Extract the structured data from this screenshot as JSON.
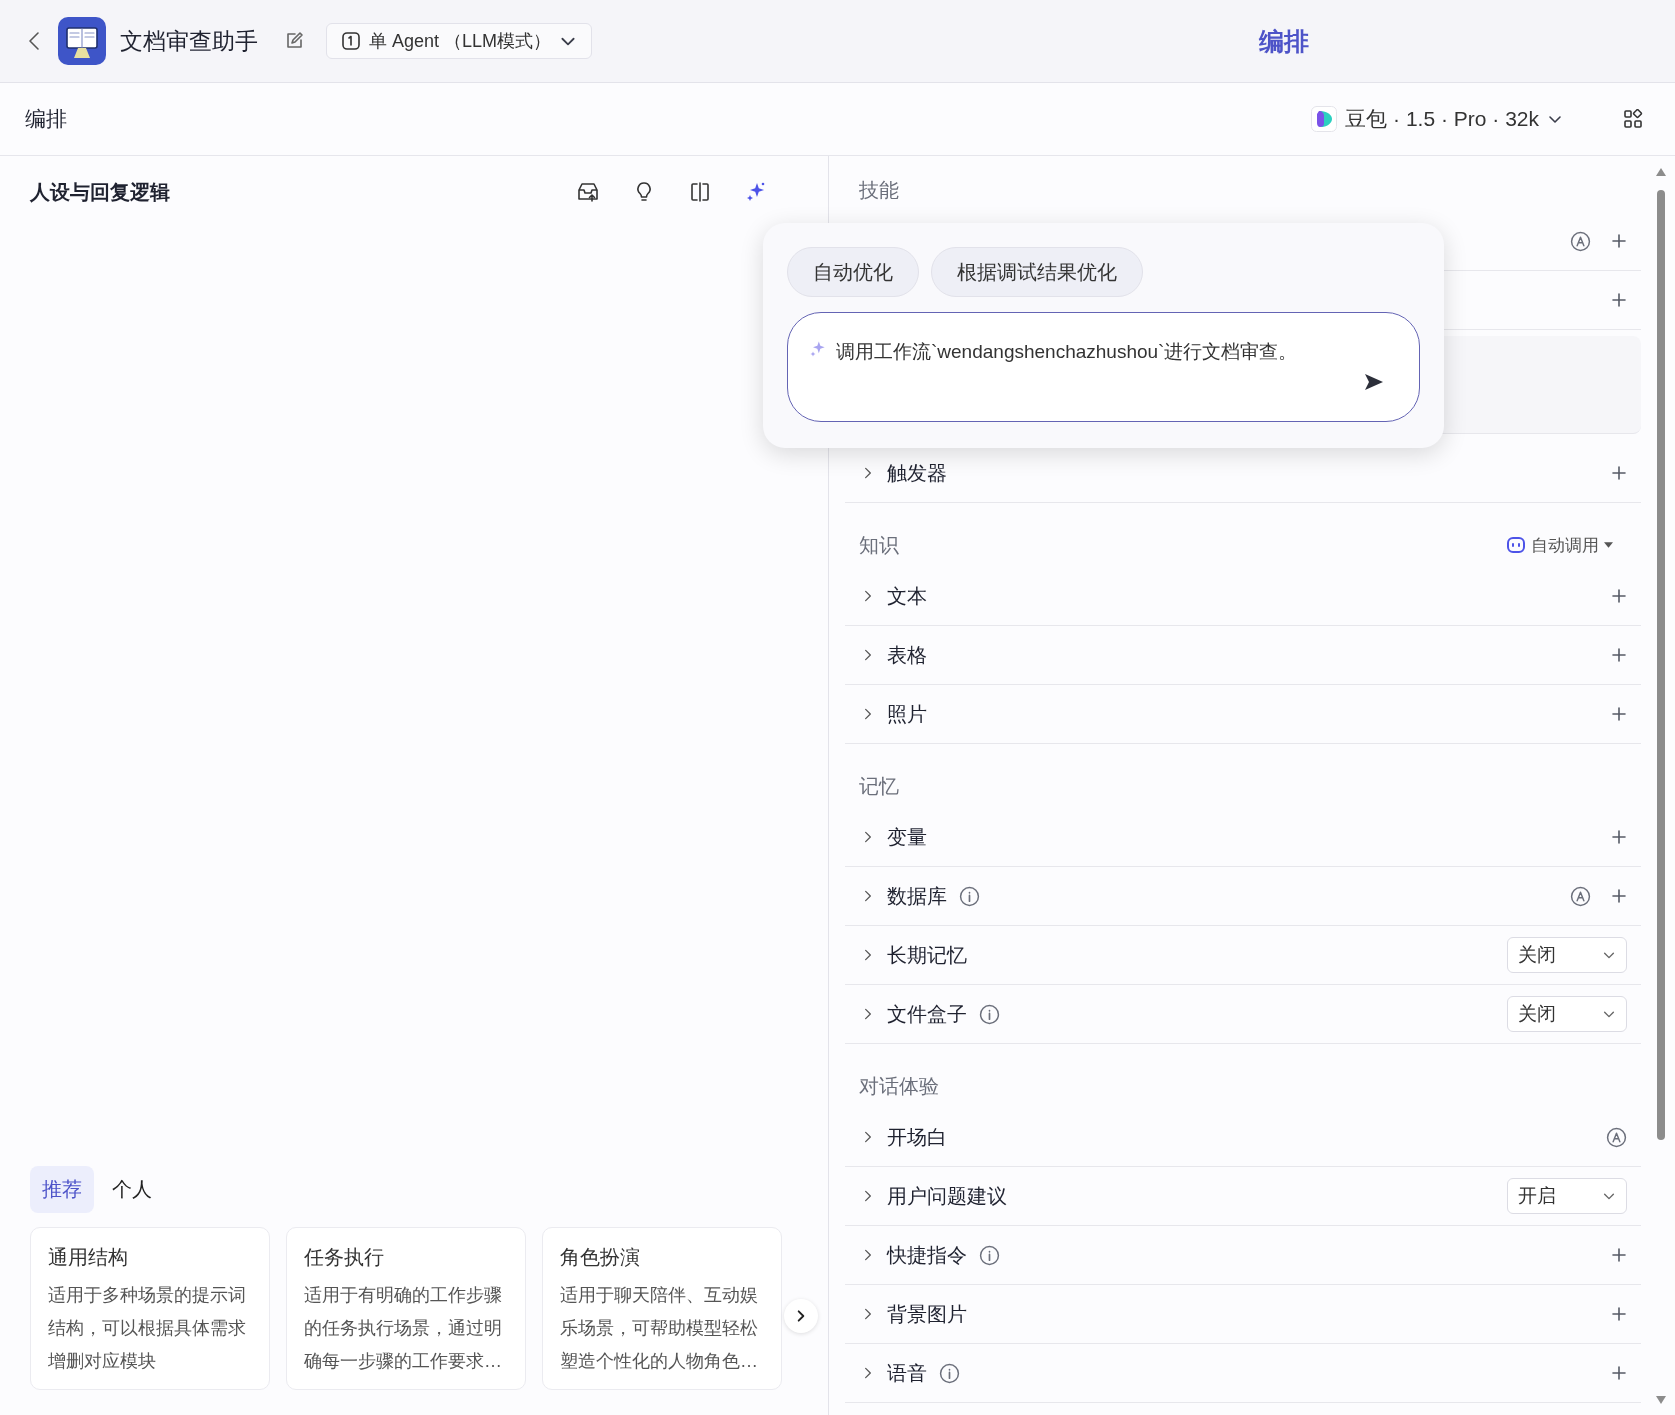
{
  "header": {
    "title": "文档审查助手",
    "mode": "单 Agent （LLM模式）",
    "tabs": [
      {
        "label": "编排",
        "selected": true
      }
    ]
  },
  "toolbar": {
    "title": "编排",
    "model": "豆包 · 1.5 · Pro · 32k"
  },
  "prompt_panel": {
    "title": "人设与回复逻辑",
    "template_tabs": [
      {
        "label": "推荐",
        "selected": true
      },
      {
        "label": "个人",
        "selected": false
      }
    ],
    "templates": [
      {
        "title": "通用结构",
        "description": "适用于多种场景的提示词结构，可以根据具体需求增删对应模块"
      },
      {
        "title": "任务执行",
        "description": "适用于有明确的工作步骤的任务执行场景，通过明确每一步骤的工作要求…"
      },
      {
        "title": "角色扮演",
        "description": "适用于聊天陪伴、互动娱乐场景，可帮助模型轻松塑造个性化的人物角色…"
      }
    ]
  },
  "optimize_popup": {
    "chips": [
      "自动优化",
      "根据调试结果优化"
    ],
    "input": {
      "value": "调用工作流`wendangshenchazhushou`进行文档审查。"
    }
  },
  "sections": [
    {
      "title": "技能",
      "rows": [
        {
          "kind": "row",
          "auto": true,
          "add": true
        },
        {
          "kind": "row",
          "add": true
        },
        {
          "kind": "blank"
        },
        {
          "kind": "row",
          "label": "触发器",
          "add": true
        }
      ]
    },
    {
      "title": "知识",
      "mode": "自动调用",
      "rows": [
        {
          "kind": "row",
          "label": "文本",
          "add": true
        },
        {
          "kind": "row",
          "label": "表格",
          "add": true
        },
        {
          "kind": "row",
          "label": "照片",
          "add": true
        }
      ]
    },
    {
      "title": "记忆",
      "rows": [
        {
          "kind": "row",
          "label": "变量",
          "add": true
        },
        {
          "kind": "row",
          "label": "数据库",
          "info": true,
          "auto": true,
          "add": true
        },
        {
          "kind": "row",
          "label": "长期记忆",
          "select": "关闭"
        },
        {
          "kind": "row",
          "label": "文件盒子",
          "info": true,
          "select": "关闭"
        }
      ]
    },
    {
      "title": "对话体验",
      "rows": [
        {
          "kind": "row",
          "label": "开场白",
          "auto": true
        },
        {
          "kind": "row",
          "label": "用户问题建议",
          "select": "开启"
        },
        {
          "kind": "row",
          "label": "快捷指令",
          "info": true,
          "add": true
        },
        {
          "kind": "row",
          "label": "背景图片",
          "add": true
        },
        {
          "kind": "row",
          "label": "语音",
          "info": true,
          "add": true
        }
      ]
    }
  ]
}
